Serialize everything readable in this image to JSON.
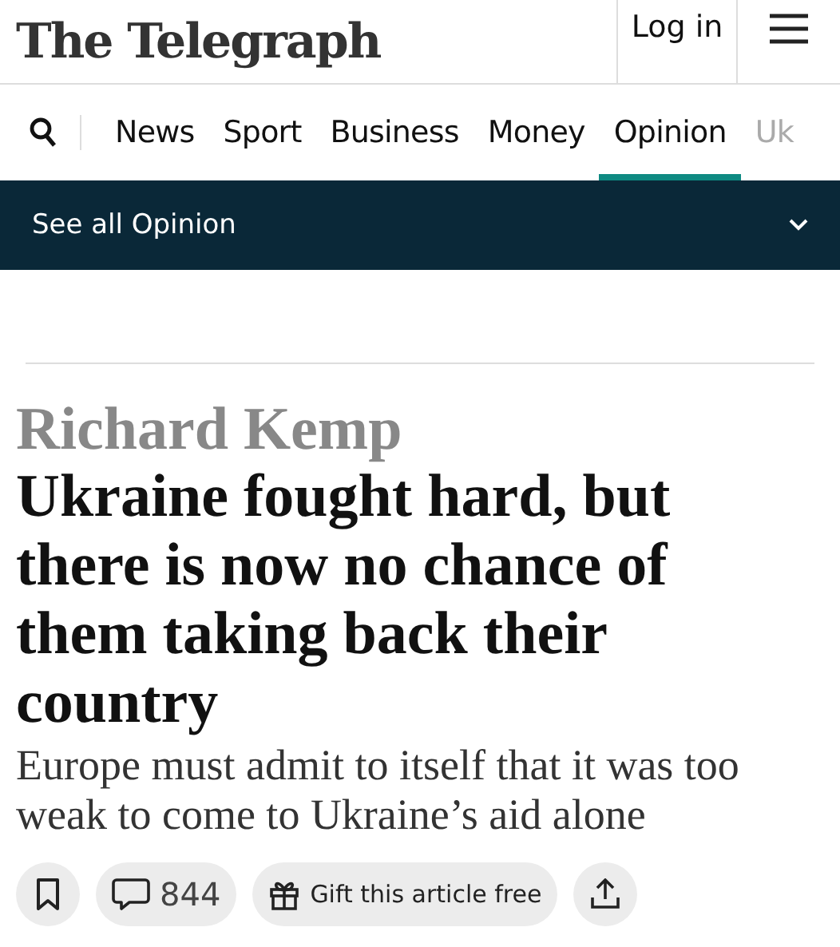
{
  "masthead": {
    "logo": "The Telegraph",
    "login": "Log in"
  },
  "nav": {
    "tabs": [
      {
        "label": "News",
        "selected": false
      },
      {
        "label": "Sport",
        "selected": false
      },
      {
        "label": "Business",
        "selected": false
      },
      {
        "label": "Money",
        "selected": false
      },
      {
        "label": "Opinion",
        "selected": true
      },
      {
        "label": "Uk",
        "selected": false
      }
    ]
  },
  "section_bar": {
    "label": "See all Opinion"
  },
  "article": {
    "author": "Richard Kemp",
    "headline": "Ukraine fought hard, but there is now no chance of them taking back their country",
    "standfirst": "Europe must admit to itself that it was too weak to come to Ukraine’s aid alone",
    "comments": "844",
    "gift": "Gift this article free"
  }
}
